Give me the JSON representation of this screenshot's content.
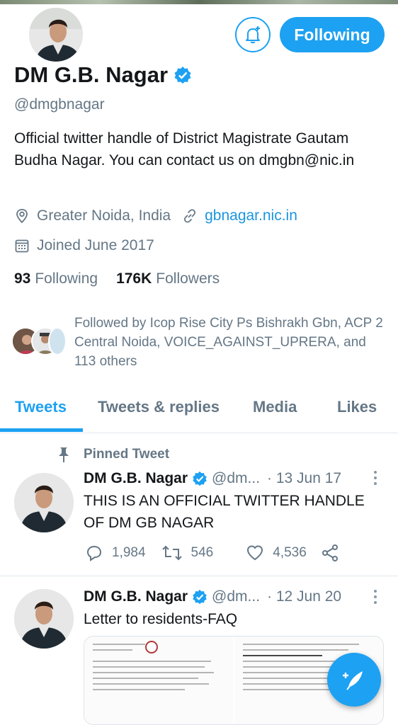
{
  "profile": {
    "name": "DM G.B. Nagar",
    "handle": "@dmgbnagar",
    "bio": "Official twitter handle of District Magistrate Gautam Budha Nagar. You can contact us on dmgbn@nic.in",
    "location": "Greater Noida, India",
    "website": "gbnagar.nic.in",
    "joined": "Joined June 2017",
    "following_count": "93",
    "following_label": "Following",
    "followers_count": "176K",
    "followers_label": "Followers",
    "followed_by": "Followed by Icop Rise City Ps Bishrakh Gbn, ACP 2 Central Noida, VOICE_AGAINST_UPRERA, and 113 others"
  },
  "header": {
    "follow_button": "Following"
  },
  "tabs": [
    {
      "label": "Tweets",
      "active": true
    },
    {
      "label": "Tweets & replies",
      "active": false
    },
    {
      "label": "Media",
      "active": false
    },
    {
      "label": "Likes",
      "active": false
    }
  ],
  "tweets": [
    {
      "pinned_label": "Pinned Tweet",
      "name": "DM G.B. Nagar",
      "handle": "@dm...",
      "date": "· 13 Jun 17",
      "text": "THIS IS AN OFFICIAL TWITTER HANDLE OF DM GB NAGAR",
      "replies": "1,984",
      "retweets": "546",
      "likes": "4,536"
    },
    {
      "name": "DM G.B. Nagar",
      "handle": "@dm...",
      "date": "· 12 Jun 20",
      "text": "Letter to residents-FAQ"
    }
  ],
  "colors": {
    "accent": "#1da1f2",
    "secondary_text": "#657786",
    "link": "#1b95e0"
  }
}
